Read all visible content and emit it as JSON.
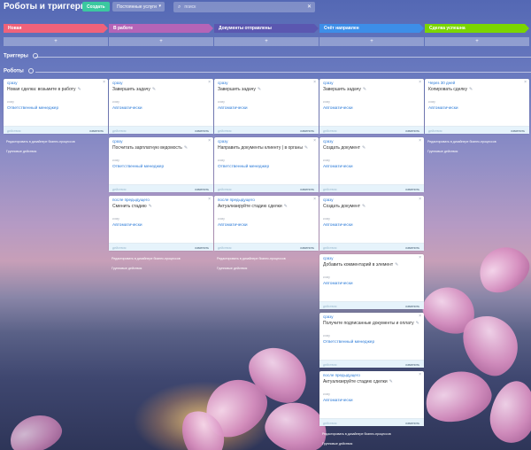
{
  "header": {
    "title": "Роботы и триггеры",
    "create_label": "Создать",
    "service_label": "Постоянные услуги",
    "search_placeholder": "поиск"
  },
  "stages": [
    {
      "label": "Новая",
      "color": "#f0627a"
    },
    {
      "label": "В работе",
      "color": "#b564b7"
    },
    {
      "label": "Документы отправлены",
      "color": "#5b57b0"
    },
    {
      "label": "Счёт направлен",
      "color": "#3d8ee8"
    },
    {
      "label": "Сделка успешна",
      "color": "#7bd500"
    }
  ],
  "add_label": "+",
  "sections": {
    "triggers": "Триггеры",
    "robots": "Роботы"
  },
  "card_labels": {
    "whom": "кому",
    "footer_left": "действия",
    "footer_right": "изменить"
  },
  "links": {
    "edit_designer": "Редактировать в дизайнере бизнес-процессов",
    "group_actions": "Групповые действия"
  },
  "columns": [
    {
      "cards": [
        {
          "when": "сразу",
          "action": "Новая сделка: возьмите в работу",
          "who": "Ответственный менеджер"
        }
      ]
    },
    {
      "cards": [
        {
          "when": "сразу",
          "action": "Завершить задачу",
          "who": "Автоматически"
        },
        {
          "when": "сразу",
          "action": "Посчитать зарплатную ведомость",
          "who": "Ответственный менеджер"
        },
        {
          "when": "после предыдущего",
          "action": "Сменить стадию",
          "who": "Автоматически"
        }
      ]
    },
    {
      "cards": [
        {
          "when": "сразу",
          "action": "Завершить задачу",
          "who": "Автоматически"
        },
        {
          "when": "сразу",
          "action": "Направить документы клиенту | в органы",
          "who": "Ответственный менеджер"
        },
        {
          "when": "после предыдущего",
          "action": "Актуализируйте стадию сделки",
          "who": "Автоматически"
        }
      ]
    },
    {
      "cards": [
        {
          "when": "сразу",
          "action": "Завершить задачу",
          "who": "Автоматически"
        },
        {
          "when": "сразу",
          "action": "Создать документ",
          "who": "Автоматически"
        },
        {
          "when": "сразу",
          "action": "Создать документ",
          "who": "Автоматически"
        },
        {
          "when": "сразу",
          "action": "Добавить комментарий в элемент",
          "who": "Автоматически"
        },
        {
          "when": "сразу",
          "action": "Получите подписанные документы и оплату",
          "who": "Ответственный менеджер"
        },
        {
          "when": "после предыдущего",
          "action": "Актуализируйте стадию сделки",
          "who": "Автоматически"
        }
      ]
    },
    {
      "cards": [
        {
          "when": "Через 30 дней",
          "action": "Копировать сделку",
          "who": "Автоматически"
        }
      ]
    }
  ]
}
